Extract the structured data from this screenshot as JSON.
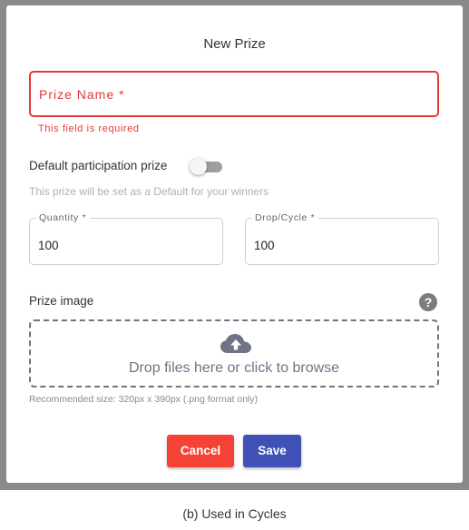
{
  "dialog": {
    "title": "New Prize",
    "prize_name": {
      "label": "Prize Name *",
      "error": "This field is required"
    },
    "default_prize": {
      "label": "Default participation prize",
      "enabled": false,
      "hint": "This prize will be set as a Default for your winners"
    },
    "quantity": {
      "label": "Quantity *",
      "value": "100"
    },
    "drop_cycle": {
      "label": "Drop/Cycle *",
      "value": "100"
    },
    "prize_image": {
      "label": "Prize image",
      "help_icon": "question-mark-icon",
      "help_glyph": "?",
      "upload_icon": "cloud-upload-icon",
      "dropzone_text": "Drop files here or click to browse",
      "recommendation": "Recommended size: 320px x 390px (.png format only)"
    },
    "buttons": {
      "cancel": "Cancel",
      "save": "Save"
    }
  },
  "caption": "(b) Used in Cycles",
  "colors": {
    "error": "#e53935",
    "cancel": "#f44336",
    "save": "#3f51b5",
    "backdrop": "#8a8a8a",
    "dropzone": "#6f7385"
  }
}
